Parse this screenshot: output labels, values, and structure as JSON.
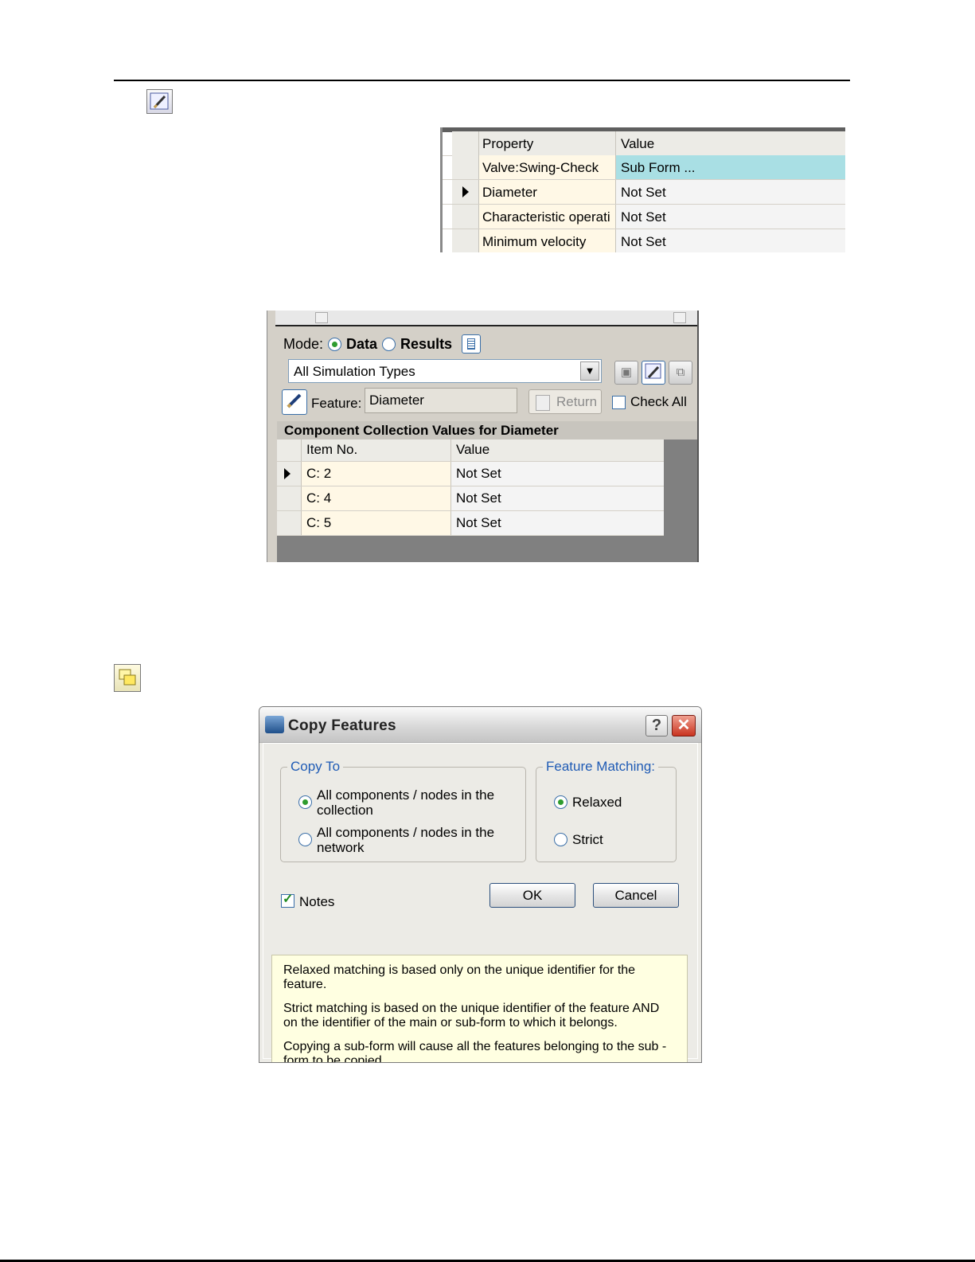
{
  "property_grid": {
    "header": {
      "property": "Property",
      "value": "Value"
    },
    "rows": [
      {
        "property": "Valve:Swing-Check",
        "value": "Sub Form ..."
      },
      {
        "property": "Diameter",
        "value": "Not Set"
      },
      {
        "property": "Characteristic operati",
        "value": "Not Set"
      },
      {
        "property": "Minimum velocity",
        "value": "Not Set"
      }
    ]
  },
  "collection_panel": {
    "mode_label": "Mode:",
    "mode_data": "Data",
    "mode_results": "Results",
    "simulation_type": "All Simulation Types",
    "feature_label": "Feature:",
    "feature_value": "Diameter",
    "return_label": "Return",
    "check_all_label": "Check All",
    "heading": "Component Collection Values for Diameter",
    "table_headers": {
      "item": "Item No.",
      "value": "Value"
    },
    "rows": [
      {
        "item": "C: 2",
        "value": "Not Set"
      },
      {
        "item": "C: 4",
        "value": "Not Set"
      },
      {
        "item": "C: 5",
        "value": "Not Set"
      }
    ]
  },
  "copy_features_dialog": {
    "title": "Copy Features",
    "help": "?",
    "close": "✕",
    "copy_to": {
      "title": "Copy To",
      "option_collection": "All components / nodes in the collection",
      "option_network": "All components / nodes in the network"
    },
    "feature_matching": {
      "title": "Feature Matching:",
      "relaxed": "Relaxed",
      "strict": "Strict"
    },
    "notes_label": "Notes",
    "ok_label": "OK",
    "cancel_label": "Cancel",
    "info": [
      "Relaxed matching is based only on the unique identifier for the feature.",
      "Strict matching is based on the unique identifier of the feature AND on the identifier of the main or sub-form to which it belongs.",
      "Copying a sub-form will cause all the features belonging to the sub -form to be copied."
    ]
  }
}
